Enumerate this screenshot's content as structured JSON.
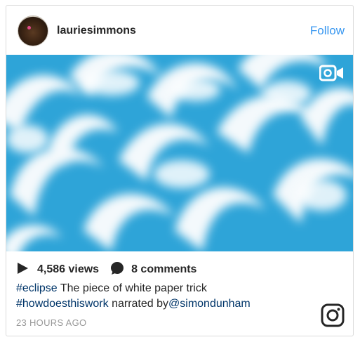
{
  "post": {
    "username": "lauriesimmons",
    "follow_label": "Follow",
    "views": "4,586 views",
    "comments": "8 comments",
    "caption_line1_tag": "#eclipse",
    "caption_line1_text": " The piece of white paper trick",
    "caption_line2_tag": "#howdoesthiswork",
    "caption_line2_text": " narrated by",
    "caption_line2_mention": "@simondunham",
    "timestamp": "23 HOURS AGO"
  },
  "icons": {
    "video": "video-camera-icon",
    "play": "play-icon",
    "comment": "comment-bubble-icon",
    "brand": "instagram-logo-icon"
  },
  "colors": {
    "link": "#3897f0",
    "hashtag": "#003569",
    "text": "#262626",
    "muted": "#999999",
    "media_blue": "#2ea4d8"
  }
}
